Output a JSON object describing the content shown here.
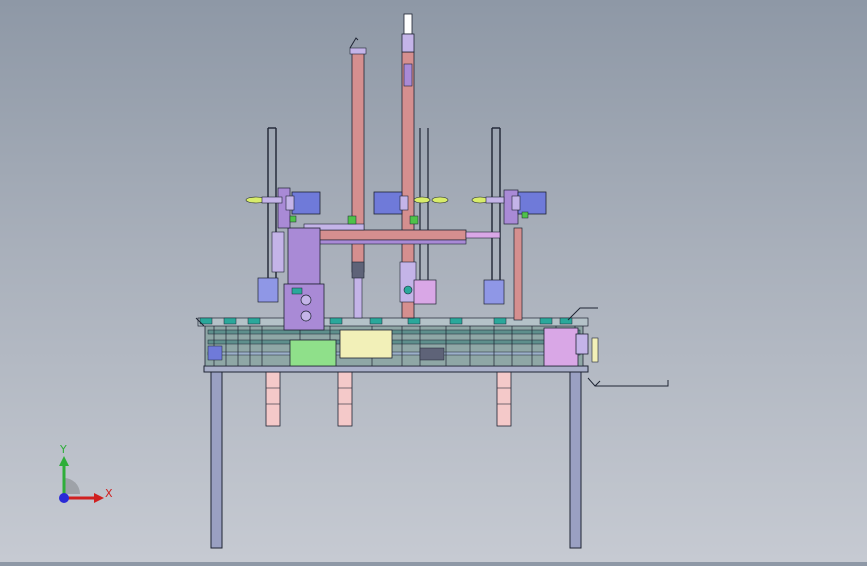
{
  "viewport": {
    "background_top": "#8e98a6",
    "background_bottom": "#c6cad2"
  },
  "model": {
    "frame_color": "#a9afc9",
    "leg_color": "#9aa0c2",
    "pink_block_color": "#f4c9c9",
    "tube_color": "#d58f8f",
    "purple_color": "#a98ad6",
    "blue_motor_color": "#6f7ad9",
    "green_block_color": "#8fe08a",
    "yellow_box_color": "#f2f0b8",
    "magenta_color": "#d9a7e6",
    "lime_color": "#d8ec6a",
    "dark_line_color": "#1e2433"
  },
  "triad": {
    "y_label": "Y",
    "x_label": "X",
    "y_color": "#2fae3a",
    "x_color": "#d02020",
    "z_color": "#2a2ad6"
  }
}
